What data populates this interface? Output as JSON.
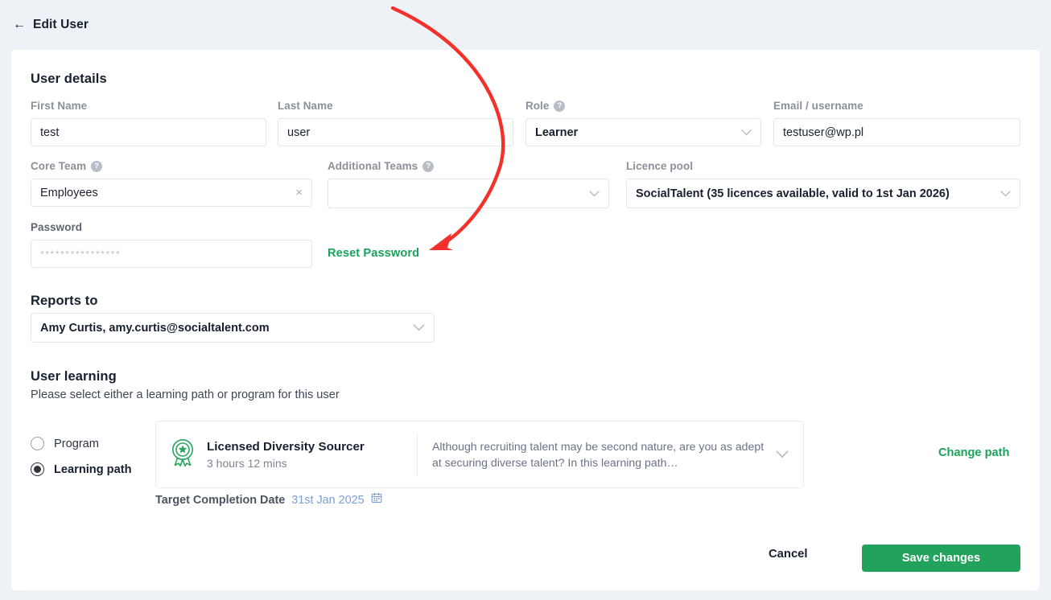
{
  "header": {
    "back_icon": "arrow-left-icon",
    "title": "Edit User"
  },
  "user_details": {
    "section_title": "User details",
    "first_name": {
      "label": "First Name",
      "value": "test"
    },
    "last_name": {
      "label": "Last Name",
      "value": "user"
    },
    "role": {
      "label": "Role",
      "help": "?",
      "value": "Learner"
    },
    "email": {
      "label": "Email / username",
      "value": "testuser@wp.pl"
    },
    "core_team": {
      "label": "Core Team",
      "help": "?",
      "value": "Employees",
      "clear": "×"
    },
    "additional_teams": {
      "label": "Additional Teams",
      "help": "?",
      "value": ""
    },
    "licence_pool": {
      "label": "Licence pool",
      "value": "SocialTalent (35 licences available, valid to 1st Jan 2026)"
    },
    "password": {
      "label": "Password",
      "placeholder": "****************"
    },
    "reset_password_link": "Reset Password"
  },
  "reports_to": {
    "label": "Reports to",
    "value": "Amy Curtis, amy.curtis@socialtalent.com"
  },
  "user_learning": {
    "section_title": "User learning",
    "subtitle": "Please select either a learning path or program for this user",
    "options": [
      {
        "label": "Program",
        "selected": false
      },
      {
        "label": "Learning path",
        "selected": true
      }
    ],
    "path_card": {
      "icon": "award-rosette-icon",
      "title": "Licensed Diversity Sourcer",
      "duration": "3 hours 12 mins",
      "description": "Although recruiting talent may be second nature, are you as adept at securing diverse talent? In this learning path…",
      "expand_icon": "chevron-down-icon"
    },
    "target_completion": {
      "label": "Target Completion Date",
      "date": "31st Jan 2025",
      "icon": "calendar-icon"
    },
    "change_path_link": "Change path"
  },
  "footer": {
    "cancel_label": "Cancel",
    "save_label": "Save changes"
  },
  "annotation": {
    "type": "curved-arrow",
    "color": "#f3312a",
    "points_to": "Reset Password"
  },
  "colors": {
    "page_bg": "#eef1f5",
    "card_bg": "#ffffff",
    "accent_green": "#22a35c",
    "link_green": "#1aa35a",
    "date_blue": "#7c9fd4",
    "annotation_red": "#f3312a"
  }
}
